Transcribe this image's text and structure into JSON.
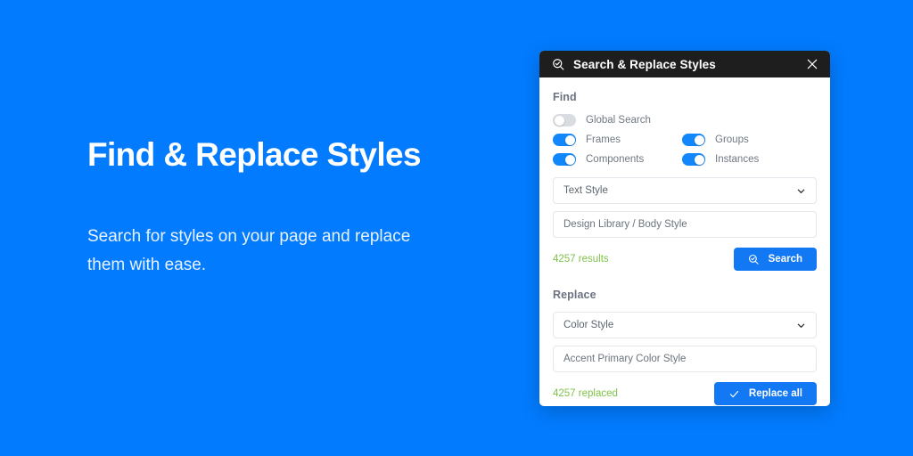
{
  "theme": {
    "background": "#027BFE",
    "panel_header_bg": "#1E1E1E",
    "accent_blue": "#1278F4",
    "toggle_on": "#1287FB",
    "toggle_off": "#D9DCE1",
    "status_green": "#7FC24A",
    "panel_bg": "#FFFFFF"
  },
  "hero": {
    "title": "Find & Replace Styles",
    "subtitle": "Search for styles on your page and replace them with ease."
  },
  "panel": {
    "header": {
      "icon": "search-check-icon",
      "title": "Search & Replace Styles",
      "close_icon": "close-icon"
    },
    "find": {
      "label": "Find",
      "toggles": [
        {
          "label": "Global Search",
          "on": false
        },
        {
          "label": "Frames",
          "on": true
        },
        {
          "label": "Groups",
          "on": true
        },
        {
          "label": "Components",
          "on": true
        },
        {
          "label": "Instances",
          "on": true
        }
      ],
      "style_type_select": {
        "value": "Text Style",
        "icon": "chevron-down-icon"
      },
      "style_name_input": {
        "value": "Design Library / Body Style",
        "placeholder": "Design Library / Body Style"
      },
      "status": "4257 results",
      "button": {
        "label": "Search",
        "icon": "search-check-icon"
      }
    },
    "replace": {
      "label": "Replace",
      "style_type_select": {
        "value": "Color Style",
        "icon": "chevron-down-icon"
      },
      "style_name_input": {
        "value": "Accent Primary Color Style",
        "placeholder": "Accent Primary Color Style"
      },
      "status": "4257 replaced",
      "button": {
        "label": "Replace all",
        "icon": "check-icon"
      }
    }
  }
}
